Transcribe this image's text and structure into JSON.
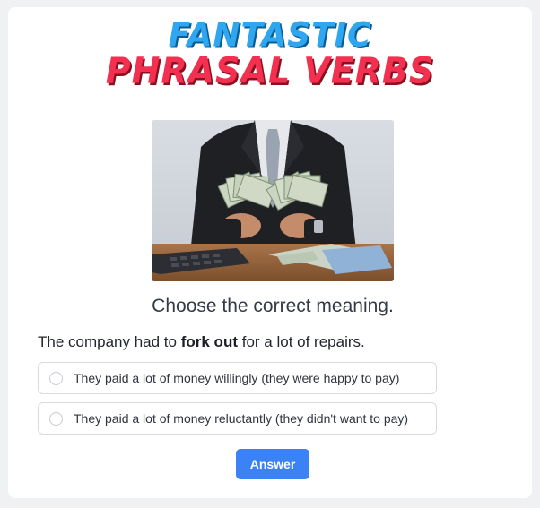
{
  "logo": {
    "line1": "FANTASTIC",
    "line2": "PHRASAL VERBS"
  },
  "question": {
    "instruction": "Choose the correct meaning.",
    "sentence_before": "The company had to ",
    "phrasal_verb": "fork out",
    "sentence_after": " for a lot of repairs."
  },
  "options": [
    {
      "label": "They paid a lot of money willingly (they were happy to pay)"
    },
    {
      "label": "They paid a lot of money reluctantly (they didn't want to pay)"
    }
  ],
  "answer_button": {
    "label": "Answer"
  },
  "colors": {
    "logo_blue": "#2ea7f0",
    "logo_red": "#f3304f",
    "button": "#3b82f6"
  }
}
